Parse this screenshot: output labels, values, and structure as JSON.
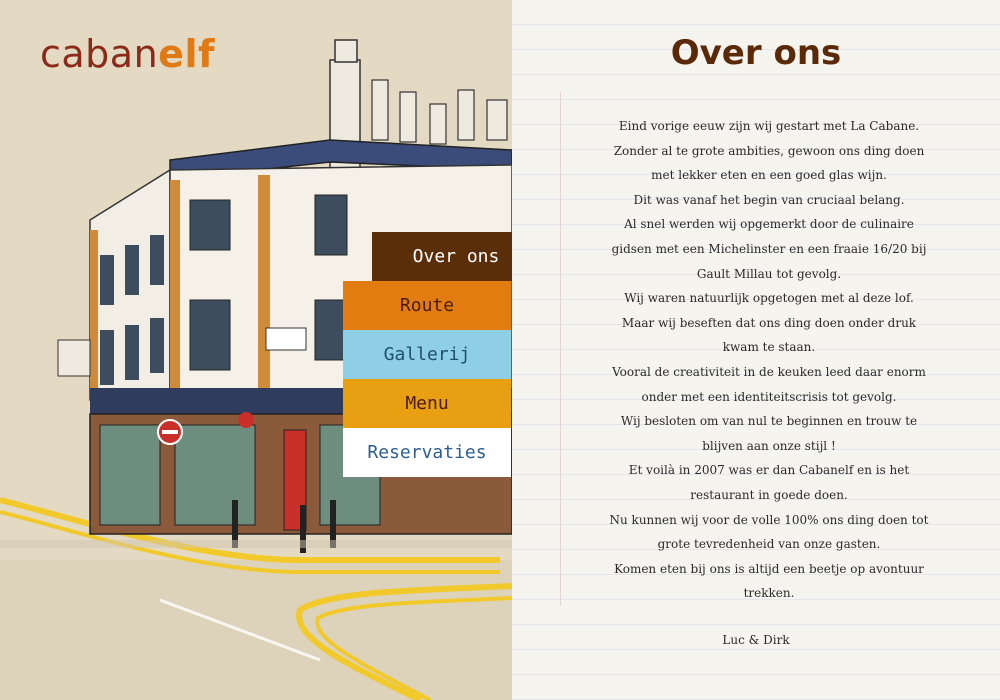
{
  "logo": {
    "text": "caban",
    "accent": "elf"
  },
  "nav": [
    {
      "label": "Over ons",
      "active": true
    },
    {
      "label": "Route"
    },
    {
      "label": "Gallerij"
    },
    {
      "label": "Menu"
    },
    {
      "label": "Reservaties"
    }
  ],
  "content": {
    "title": "Over ons",
    "lines": [
      "Eind vorige eeuw zijn wij gestart met La Cabane.",
      "Zonder al te grote ambities, gewoon ons ding doen",
      "met lekker eten en een goed glas wijn.",
      "Dit was vanaf het begin van cruciaal belang.",
      "Al snel werden wij opgemerkt door de culinaire",
      "gidsen met een Michelinster en een fraaie 16/20 bij",
      "Gault Millau tot gevolg.",
      "Wij waren natuurlijk opgetogen met al deze lof.",
      "Maar wij beseften dat ons ding doen onder druk",
      "kwam te staan.",
      "Vooral de creativiteit in de keuken leed daar enorm",
      "onder met een identiteitscrisis tot gevolg.",
      "Wij besloten om van nul te beginnen en trouw te",
      "blijven aan onze stijl !",
      "Et voilà in 2007 was er dan Cabanelf en is het",
      "restaurant in goede doen.",
      "Nu kunnen wij voor de volle 100% ons ding doen tot",
      "grote tevredenheid van onze gasten.",
      "Komen eten bij ons is altijd een beetje op avontuur",
      "trekken."
    ],
    "signature": "Luc & Dirk"
  },
  "colors": {
    "brand": "#8a2a18",
    "accent": "#e07a15",
    "title": "#5a2a08"
  }
}
